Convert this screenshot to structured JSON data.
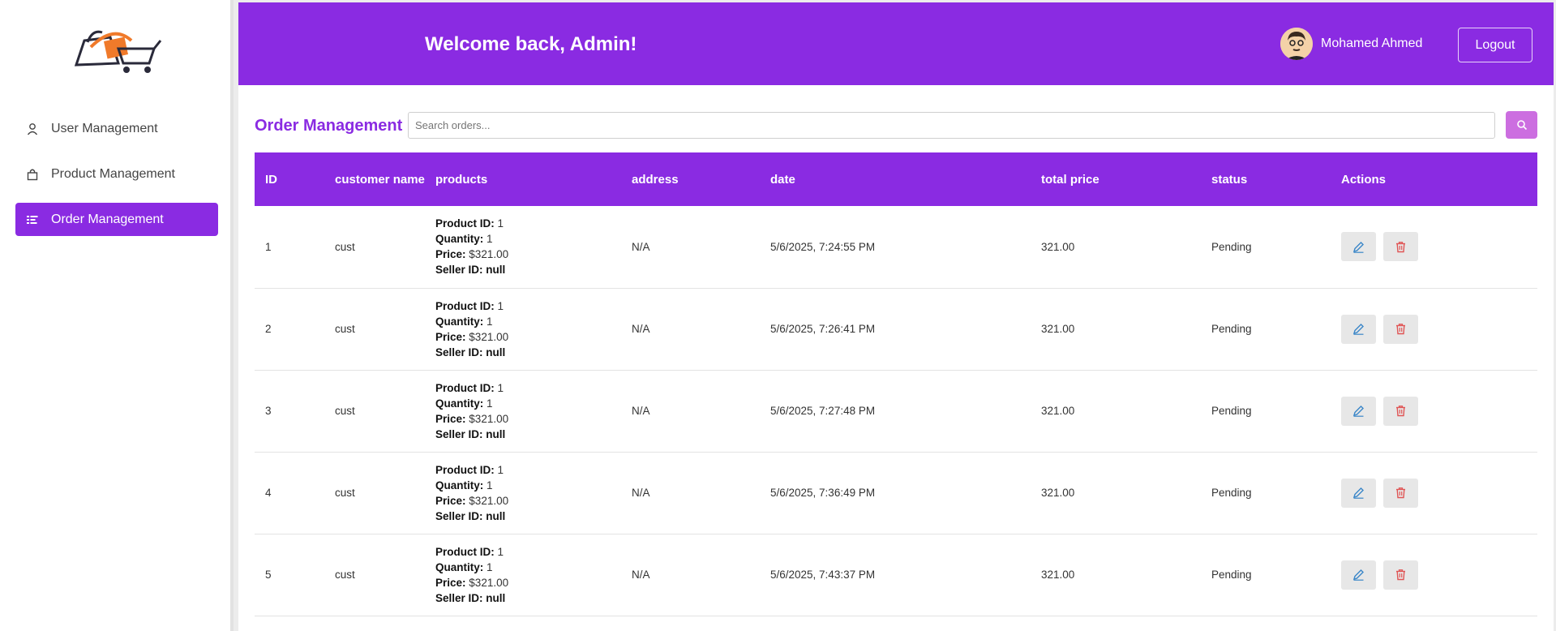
{
  "sidebar": {
    "items": [
      {
        "label": "User Management",
        "icon": "user-icon"
      },
      {
        "label": "Product Management",
        "icon": "bag-icon"
      },
      {
        "label": "Order Management",
        "icon": "list-icon",
        "active": true
      }
    ]
  },
  "header": {
    "welcome": "Welcome back, Admin!",
    "user_name": "Mohamed Ahmed",
    "logout_label": "Logout"
  },
  "orders": {
    "title": "Order Management",
    "search_placeholder": "Search orders...",
    "columns": [
      "ID",
      "customer name",
      "products",
      "address",
      "date",
      "total price",
      "status",
      "Actions"
    ],
    "product_labels": {
      "id": "Product ID:",
      "qty": "Quantity:",
      "price": "Price:",
      "seller": "Seller ID:"
    },
    "rows": [
      {
        "id": "1",
        "customer": "cust",
        "product_id": "1",
        "quantity": "1",
        "price": "$321.00",
        "seller": "null",
        "address": "N/A",
        "date": "5/6/2025, 7:24:55 PM",
        "total": "321.00",
        "status": "Pending"
      },
      {
        "id": "2",
        "customer": "cust",
        "product_id": "1",
        "quantity": "1",
        "price": "$321.00",
        "seller": "null",
        "address": "N/A",
        "date": "5/6/2025, 7:26:41 PM",
        "total": "321.00",
        "status": "Pending"
      },
      {
        "id": "3",
        "customer": "cust",
        "product_id": "1",
        "quantity": "1",
        "price": "$321.00",
        "seller": "null",
        "address": "N/A",
        "date": "5/6/2025, 7:27:48 PM",
        "total": "321.00",
        "status": "Pending"
      },
      {
        "id": "4",
        "customer": "cust",
        "product_id": "1",
        "quantity": "1",
        "price": "$321.00",
        "seller": "null",
        "address": "N/A",
        "date": "5/6/2025, 7:36:49 PM",
        "total": "321.00",
        "status": "Pending"
      },
      {
        "id": "5",
        "customer": "cust",
        "product_id": "1",
        "quantity": "1",
        "price": "$321.00",
        "seller": "null",
        "address": "N/A",
        "date": "5/6/2025, 7:43:37 PM",
        "total": "321.00",
        "status": "Pending"
      }
    ]
  },
  "colors": {
    "accent": "#8a2be2",
    "search_button": "#cc6ee0",
    "edit": "#3a86c8",
    "delete": "#e05555"
  }
}
